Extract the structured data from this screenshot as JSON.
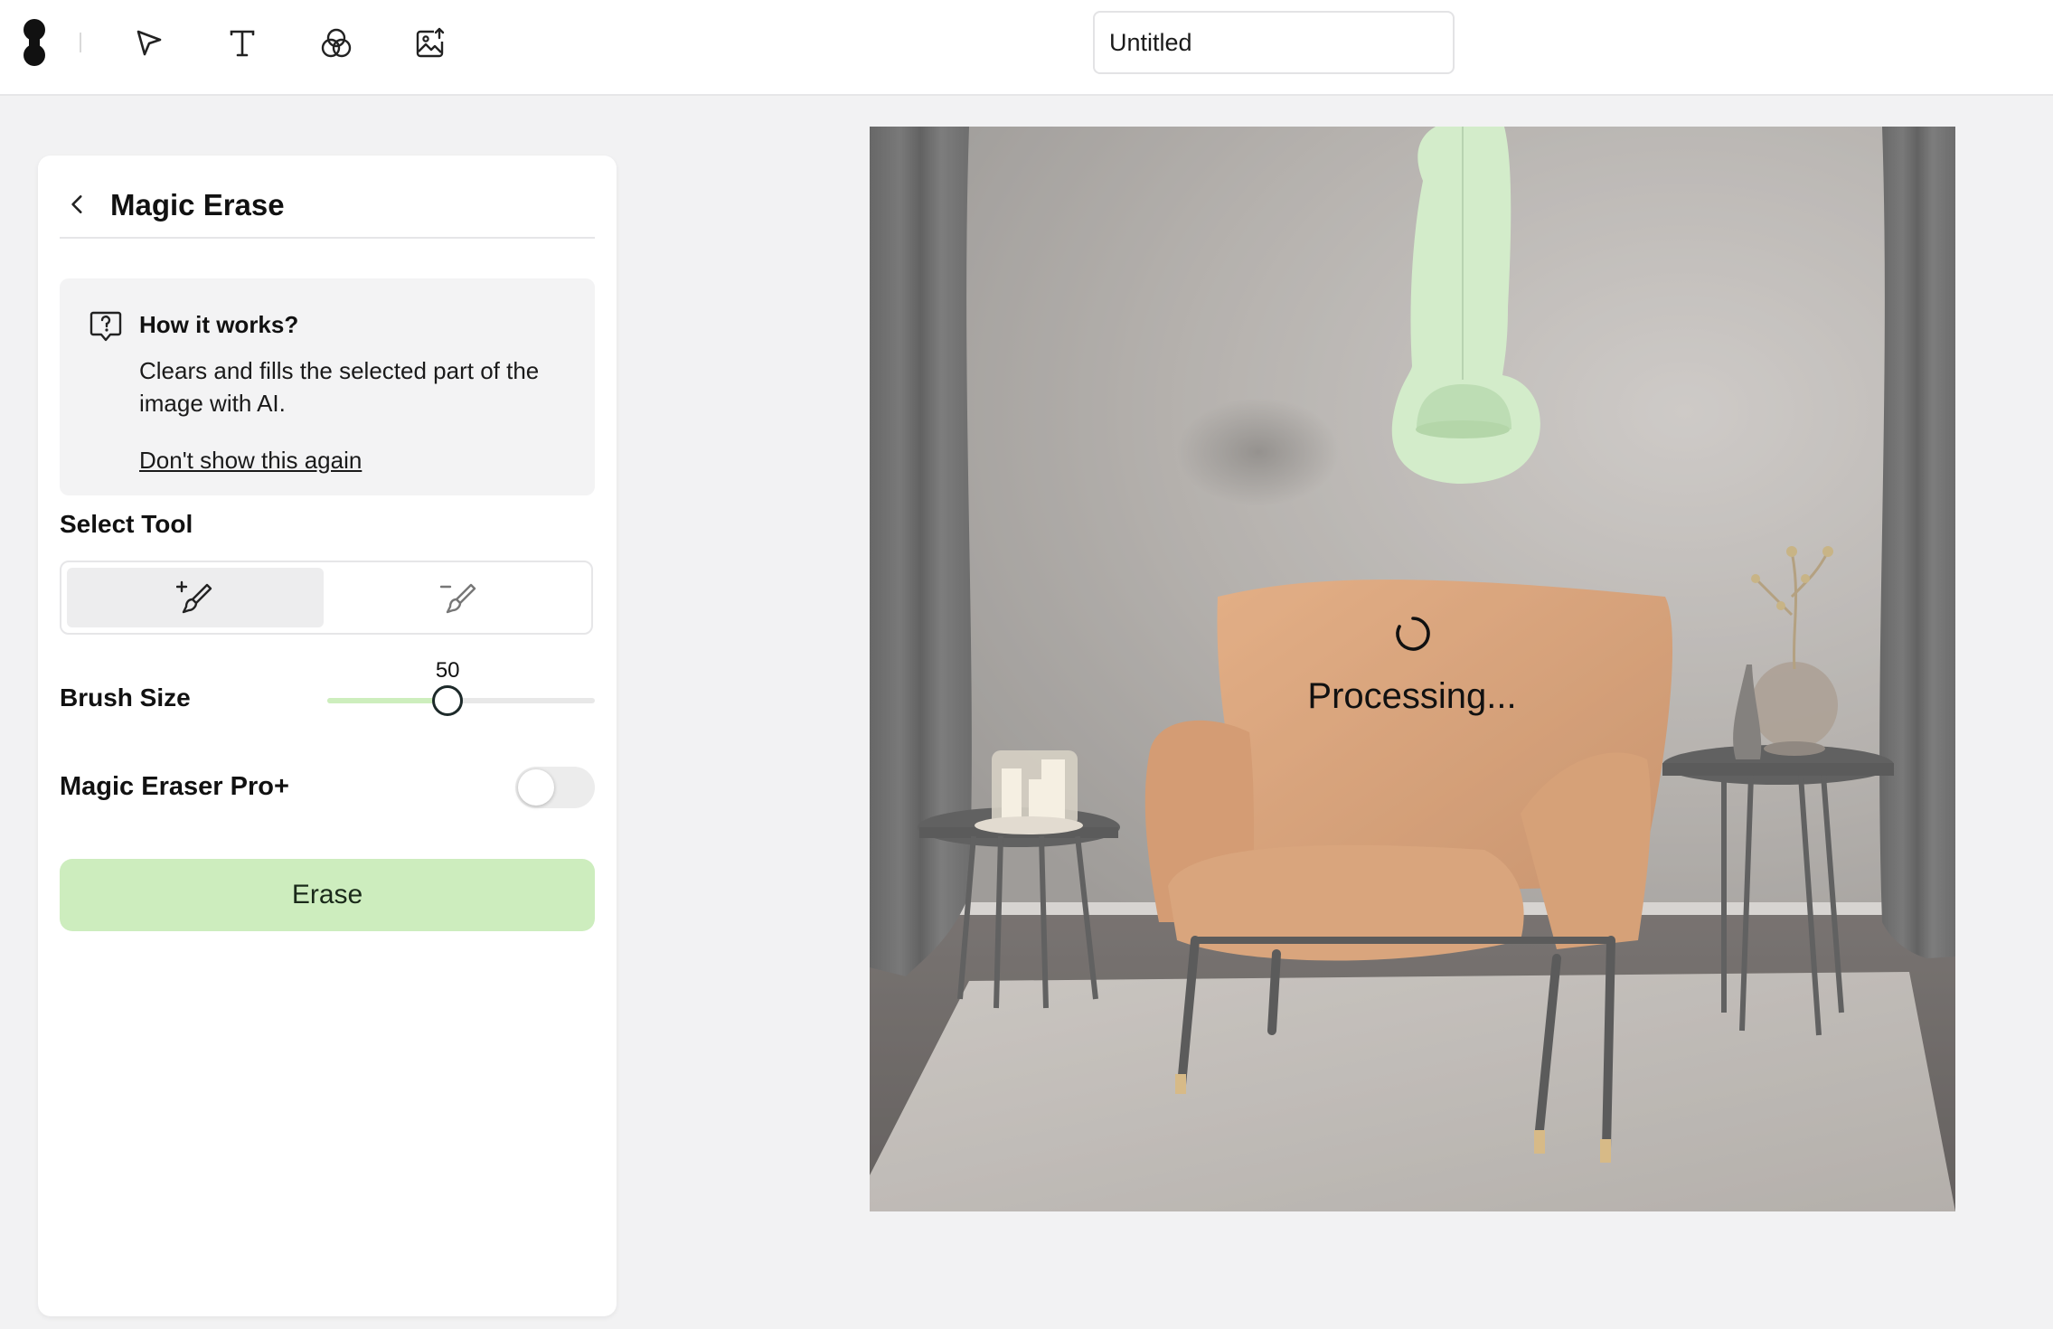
{
  "toolbar": {
    "logo_icon": "brand-logo-icon",
    "tools": [
      {
        "name": "select",
        "icon": "cursor-arrow-icon"
      },
      {
        "name": "text",
        "icon": "text-T-icon"
      },
      {
        "name": "filters",
        "icon": "overlapping-circles-icon"
      },
      {
        "name": "image-upload",
        "icon": "image-add-icon"
      }
    ],
    "document_title": "Untitled"
  },
  "panel": {
    "title": "Magic Erase",
    "info": {
      "title": "How it works?",
      "text": "Clears and fills the selected part of the image with AI.",
      "dismiss_link": "Don't show this again"
    },
    "select_tool_label": "Select Tool",
    "tools": {
      "add_brush_icon": "brush-add-icon",
      "remove_brush_icon": "brush-remove-icon",
      "active": "add"
    },
    "brush_size_label": "Brush Size",
    "brush_size_value": "50",
    "brush_size_fraction": 0.45,
    "pro_label": "Magic Eraser Pro+",
    "pro_enabled": false,
    "erase_button": "Erase"
  },
  "canvas": {
    "status_text": "Processing...",
    "mask_color": "#c4e6b8"
  },
  "colors": {
    "accent_green": "#cdedbe",
    "slider_fill": "#cdeebd",
    "background": "#f2f2f3"
  }
}
